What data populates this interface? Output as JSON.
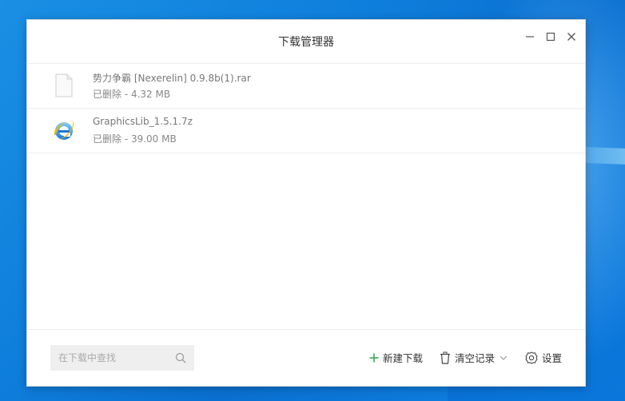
{
  "window": {
    "title": "下载管理器"
  },
  "downloads": [
    {
      "name": "势力争霸 [Nexerelin] 0.9.8b(1).rar",
      "status": "已删除 - 4.32 MB",
      "icon": "generic-file-icon"
    },
    {
      "name": "GraphicsLib_1.5.1.7z",
      "status": "已删除 - 39.00 MB",
      "icon": "internet-explorer-icon"
    }
  ],
  "footer": {
    "search_placeholder": "在下载中查找",
    "new_download_label": "新建下载",
    "clear_records_label": "清空记录",
    "settings_label": "设置"
  },
  "colors": {
    "accent_green": "#28a745",
    "desktop_blue": "#0f7fdc"
  }
}
